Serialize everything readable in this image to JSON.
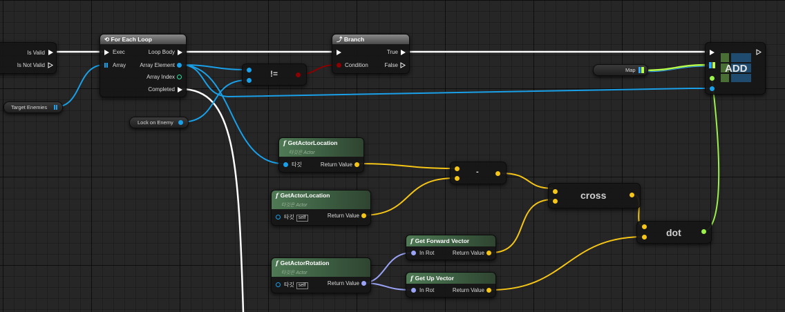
{
  "graph": {
    "is_valid_node": {
      "is_valid_label": "Is Valid",
      "is_not_valid_label": "Is Not Valid"
    },
    "for_each_loop": {
      "title": "For Each Loop",
      "exec_label": "Exec",
      "array_label": "Array",
      "loop_body_label": "Loop Body",
      "array_element_label": "Array Element",
      "array_index_label": "Array Index",
      "completed_label": "Completed"
    },
    "branch": {
      "title": "Branch",
      "condition_label": "Condition",
      "true_label": "True",
      "false_label": "False"
    },
    "not_equal": {
      "symbol": "!="
    },
    "add_node": {
      "title": "ADD"
    },
    "variables": {
      "target_enemies": "Target Enemies",
      "lock_on_enemy": "Lock on Enemy",
      "map": "Map"
    },
    "get_actor_location_1": {
      "title": "GetActorLocation",
      "subtitle": "타깃은 Actor",
      "target_label": "타깃",
      "return_label": "Return Value"
    },
    "get_actor_location_2": {
      "title": "GetActorLocation",
      "subtitle": "타깃은 Actor",
      "target_label": "타깃",
      "self_label": "self",
      "return_label": "Return Value"
    },
    "get_actor_rotation": {
      "title": "GetActorRotation",
      "subtitle": "타깃은 Actor",
      "target_label": "타깃",
      "self_label": "self",
      "return_label": "Return Value"
    },
    "subtract": {
      "symbol": "-"
    },
    "cross": {
      "title": "cross"
    },
    "dot": {
      "title": "dot"
    },
    "get_forward_vector": {
      "title": "Get Forward Vector",
      "in_label": "In Rot",
      "return_label": "Return Value"
    },
    "get_up_vector": {
      "title": "Get Up Vector",
      "in_label": "In Rot",
      "return_label": "Return Value"
    }
  },
  "colors": {
    "exec": "#ffffff",
    "object": "#1aa0e8",
    "vector": "#f5c518",
    "rotator": "#9aa3f5",
    "boolean": "#8c0000",
    "float": "#9cf24a",
    "map_key": "#2aa6ff",
    "map_value": "#b7ff4a"
  }
}
